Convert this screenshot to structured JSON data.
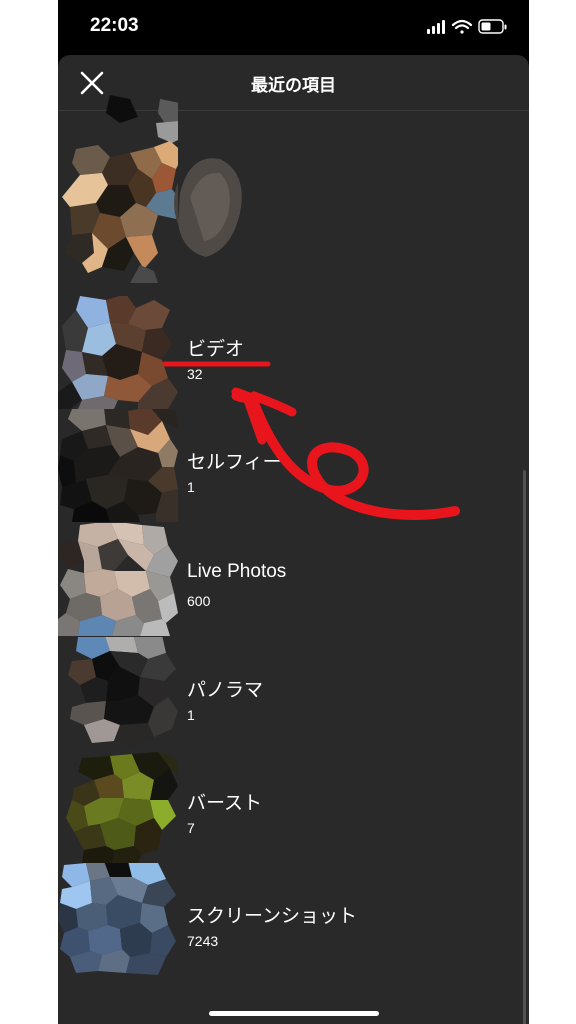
{
  "status_bar": {
    "time": "22:03"
  },
  "header": {
    "title": "最近の項目",
    "close_icon": "close-icon"
  },
  "albums": [
    {
      "name": "",
      "count": ""
    },
    {
      "name": "ビデオ",
      "count": "32"
    },
    {
      "name": "セルフィー",
      "count": "1"
    },
    {
      "name": "Live Photos",
      "count": "600"
    },
    {
      "name": "パノラマ",
      "count": "1"
    },
    {
      "name": "バースト",
      "count": "7"
    },
    {
      "name": "スクリーンショット",
      "count": "7243"
    }
  ],
  "annotation": {
    "color": "#e8161c",
    "icon": "red-arrow-annotation"
  },
  "colors": {
    "sheet": "#292929",
    "background": "#000000"
  }
}
